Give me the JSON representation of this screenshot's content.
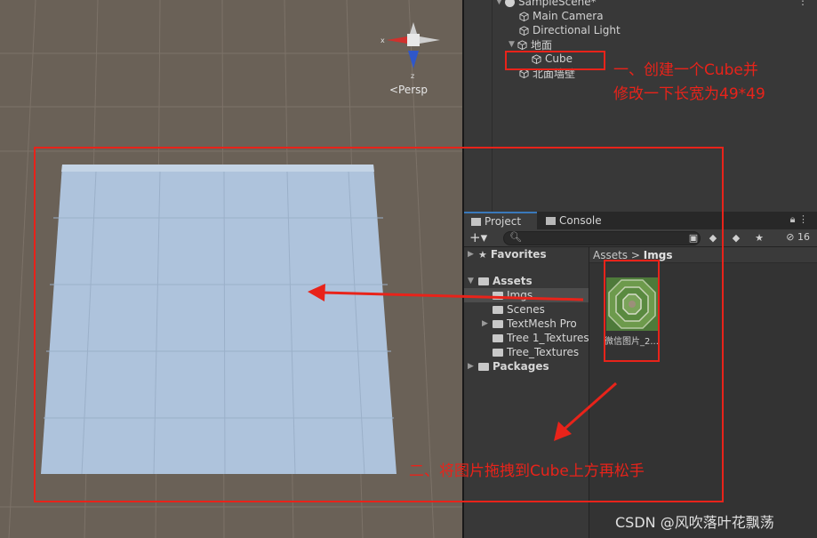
{
  "scene": {
    "gizmo_x_label": "x",
    "gizmo_z_label": "z",
    "projection_label": "<Persp"
  },
  "hierarchy": {
    "scene_name": "SampleScene*",
    "items": [
      {
        "label": "Main Camera"
      },
      {
        "label": "Directional Light"
      },
      {
        "label": "地面"
      },
      {
        "label": "Cube"
      },
      {
        "label": "北面墙壁"
      }
    ]
  },
  "tabs": {
    "project": "Project",
    "console": "Console"
  },
  "toolbar": {
    "plus": "+▾",
    "hidden_count": "16"
  },
  "project_tree": {
    "favorites": "Favorites",
    "assets": "Assets",
    "children": [
      "Imgs",
      "Scenes",
      "TextMesh Pro",
      "Tree 1_Textures",
      "Tree_Textures"
    ],
    "packages": "Packages"
  },
  "project_main": {
    "breadcrumb_root": "Assets",
    "breadcrumb_sep": ">",
    "breadcrumb_current": "Imgs",
    "asset_label": "微信图片_2..."
  },
  "annotations": {
    "step1_line1": "一、创建一个Cube并",
    "step1_line2": "修改一下长宽为49*49",
    "step2": "二、将图片拖拽到Cube上方再松手",
    "color": "#e8231a"
  },
  "watermark": "CSDN @风吹落叶花飘荡"
}
